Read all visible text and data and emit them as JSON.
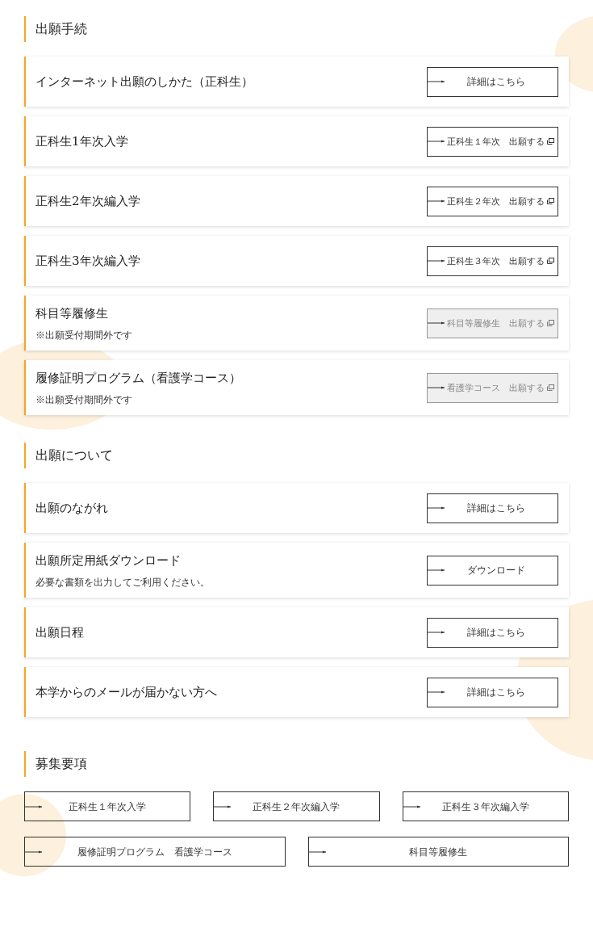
{
  "sections": [
    {
      "kind": "cards",
      "title": "出願手続",
      "items": [
        {
          "title": "インターネット出願のしかた（正科生）",
          "button": {
            "label": "詳細はこちら",
            "disabled": false,
            "external": false
          }
        },
        {
          "title": "正科生1年次入学",
          "button": {
            "label": "正科生１年次　出願する",
            "disabled": false,
            "external": true
          }
        },
        {
          "title": "正科生2年次編入学",
          "button": {
            "label": "正科生２年次　出願する",
            "disabled": false,
            "external": true
          }
        },
        {
          "title": "正科生3年次編入学",
          "button": {
            "label": "正科生３年次　出願する",
            "disabled": false,
            "external": true
          }
        },
        {
          "title": "科目等履修生",
          "note": "※出願受付期間外です",
          "button": {
            "label": "科目等履修生　出願する",
            "disabled": true,
            "external": true
          }
        },
        {
          "title": "履修証明プログラム（看護学コース）",
          "note": "※出願受付期間外です",
          "button": {
            "label": "看護学コース　出願する",
            "disabled": true,
            "external": true
          }
        }
      ]
    },
    {
      "kind": "cards",
      "title": "出願について",
      "items": [
        {
          "title": "出願のながれ",
          "button": {
            "label": "詳細はこちら",
            "disabled": false,
            "external": false
          }
        },
        {
          "title": "出願所定用紙ダウンロード",
          "note": "必要な書類を出力してご利用ください。",
          "button": {
            "label": "ダウンロード",
            "disabled": false,
            "external": false
          }
        },
        {
          "title": "出願日程",
          "button": {
            "label": "詳細はこちら",
            "disabled": false,
            "external": false
          }
        },
        {
          "title": "本学からのメールが届かない方へ",
          "button": {
            "label": "詳細はこちら",
            "disabled": false,
            "external": false
          }
        }
      ]
    },
    {
      "kind": "links",
      "title": "募集要項",
      "rows": [
        [
          "正科生１年次入学",
          "正科生２年次編入学",
          "正科生３年次編入学"
        ],
        [
          "履修証明プログラム　看護学コース",
          "科目等履修生"
        ]
      ]
    }
  ]
}
